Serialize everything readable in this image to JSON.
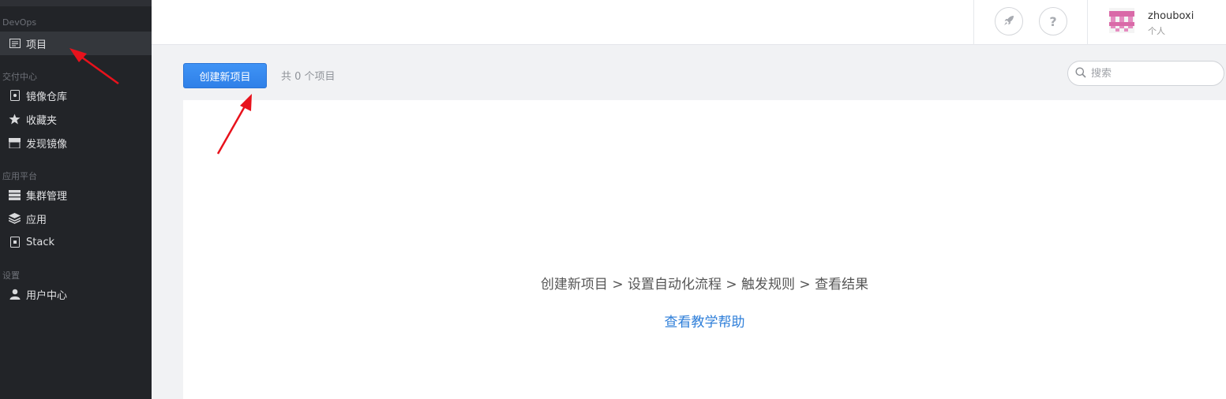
{
  "sidebar": {
    "sections": [
      {
        "label": "DevOps"
      },
      {
        "label": "交付中心"
      },
      {
        "label": "应用平台"
      },
      {
        "label": "设置"
      }
    ],
    "items": [
      {
        "label": "项目",
        "icon": "folder-icon"
      },
      {
        "label": "镜像仓库",
        "icon": "repository-icon"
      },
      {
        "label": "收藏夹",
        "icon": "star-icon"
      },
      {
        "label": "发现镜像",
        "icon": "store-icon"
      },
      {
        "label": "集群管理",
        "icon": "server-icon"
      },
      {
        "label": "应用",
        "icon": "layers-icon"
      },
      {
        "label": "Stack",
        "icon": "stack-icon"
      },
      {
        "label": "用户中心",
        "icon": "user-icon"
      }
    ],
    "active_item": "项目"
  },
  "header": {
    "rocket_button_icon": "rocket-icon",
    "help_button_label": "?",
    "user": {
      "name": "zhouboxi",
      "role": "个人"
    }
  },
  "toolbar": {
    "create_label": "创建新项目",
    "count_text": "共 0 个项目",
    "search_placeholder": "搜索"
  },
  "empty_state": {
    "steps_text": "创建新项目 > 设置自动化流程 > 触发规则 > 查看结果",
    "help_link": "查看教学帮助"
  },
  "colors": {
    "sidebar_bg": "#222428",
    "accent": "#2f80e8",
    "link": "#2f7fd9",
    "annotation_arrow": "#e8121c"
  }
}
